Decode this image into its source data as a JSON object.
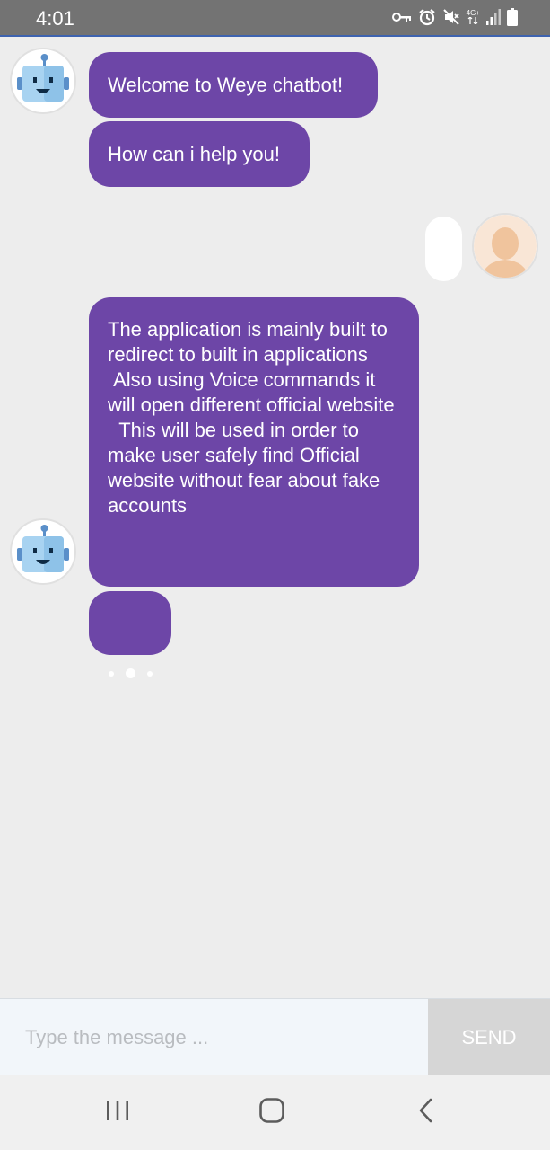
{
  "status_bar": {
    "time": "4:01",
    "network_label": "4G+",
    "icons": [
      "vpn-key-icon",
      "alarm-icon",
      "mute-icon",
      "signal-icon",
      "battery-icon"
    ]
  },
  "chat": {
    "messages": [
      {
        "sender": "bot",
        "text": "Welcome to Weye chatbot!"
      },
      {
        "sender": "bot",
        "text": "How can i help you!"
      },
      {
        "sender": "user",
        "text": ""
      },
      {
        "sender": "bot",
        "text": "The application is mainly built to redirect to built in applications\n Also using Voice commands it will open different official website\n  This will be used in order to make user safely find Official website without fear about fake accounts"
      },
      {
        "sender": "bot",
        "typing": true
      }
    ],
    "bot_avatar_icon": "robot-icon",
    "user_avatar_icon": "user-avatar-icon"
  },
  "composer": {
    "placeholder": "Type the message ...",
    "value": "",
    "send_label": "SEND"
  },
  "nav_bar": {
    "icons": [
      "recent-apps-icon",
      "home-icon",
      "back-icon"
    ]
  },
  "colors": {
    "bot_bubble": "#6d46a7",
    "user_bubble": "#ffffff",
    "background": "#ededed",
    "status_bar": "#737373",
    "send_button": "#d6d6d6",
    "input_background": "#f2f6fa"
  }
}
